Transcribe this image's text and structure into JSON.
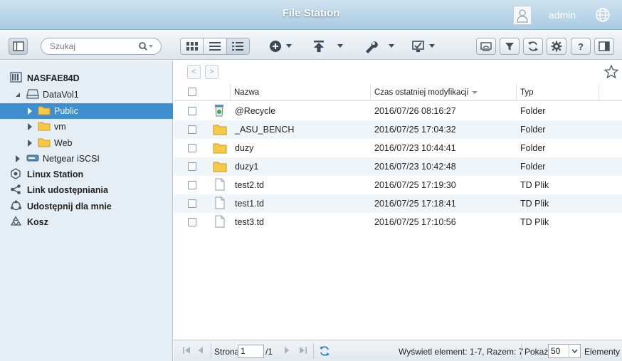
{
  "window": {
    "title": "File Station",
    "user": "admin"
  },
  "toolbar": {
    "search_placeholder": "Szukaj"
  },
  "sidebar": {
    "items": [
      {
        "label": "NASFAE84D",
        "icon": "nas-icon",
        "bold": true
      },
      {
        "label": "DataVol1",
        "icon": "disk-icon",
        "bold": false
      },
      {
        "label": "Public",
        "icon": "folder-icon",
        "bold": false,
        "selected": true
      },
      {
        "label": "vm",
        "icon": "folder-icon",
        "bold": false
      },
      {
        "label": "Web",
        "icon": "folder-icon",
        "bold": false
      },
      {
        "label": "Netgear iSCSI",
        "icon": "iscsi-disk-icon",
        "bold": false
      },
      {
        "label": "Linux Station",
        "icon": "linux-station-icon",
        "bold": true
      },
      {
        "label": "Link udostępniania",
        "icon": "share-link-icon",
        "bold": true
      },
      {
        "label": "Udostępnij dla mnie",
        "icon": "shared-with-me-icon",
        "bold": true
      },
      {
        "label": "Kosz",
        "icon": "recycle-icon",
        "bold": true
      }
    ]
  },
  "table": {
    "columns": [
      "Nazwa",
      "Czas ostatniej modyfikacji",
      "Typ"
    ],
    "rows": [
      {
        "name": "@Recycle",
        "modified": "2016/07/26 08:16:27",
        "type": "Folder",
        "icon": "recycle-bin-icon"
      },
      {
        "name": "_ASU_BENCH",
        "modified": "2016/07/25 17:04:32",
        "type": "Folder",
        "icon": "folder-icon"
      },
      {
        "name": "duzy",
        "modified": "2016/07/23 10:44:41",
        "type": "Folder",
        "icon": "folder-icon"
      },
      {
        "name": "duzy1",
        "modified": "2016/07/23 10:42:48",
        "type": "Folder",
        "icon": "folder-icon"
      },
      {
        "name": "test2.td",
        "modified": "2016/07/25 17:19:30",
        "type": "TD Plik",
        "icon": "file-icon"
      },
      {
        "name": "test1.td",
        "modified": "2016/07/25 17:18:41",
        "type": "TD Plik",
        "icon": "file-icon"
      },
      {
        "name": "test3.td",
        "modified": "2016/07/25 17:10:56",
        "type": "TD Plik",
        "icon": "file-icon"
      }
    ]
  },
  "footer": {
    "page_label": "Strona",
    "page_value": "1",
    "page_total": "/1",
    "summary": "Wyświetl element: 1-7, Razem: 7",
    "show_label": "Pokaż",
    "show_value": "50",
    "items_label": "Elementy"
  },
  "colors": {
    "accent": "#3d8fcf",
    "folder": "#f5c342",
    "sidebar_bg": "#e6eef5"
  }
}
